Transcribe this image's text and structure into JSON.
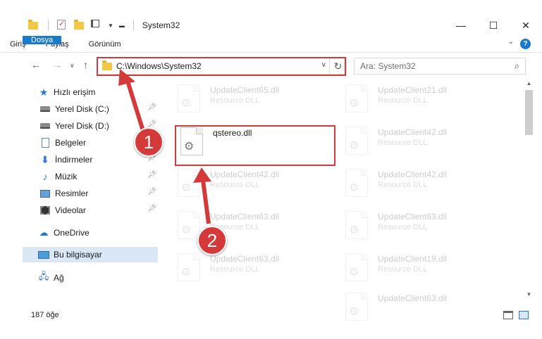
{
  "window": {
    "title": "System32",
    "controls": {
      "minimize": "—",
      "maximize": "☐",
      "close": "✕"
    }
  },
  "ribbon": {
    "tabs": [
      "Dosya",
      "Giriş",
      "Paylaş",
      "Görünüm"
    ],
    "help": "?"
  },
  "address": {
    "path": "C:\\Windows\\System32",
    "search_placeholder": "Ara: System32"
  },
  "nav": {
    "quick_access": "Hızlı erişim",
    "items": [
      {
        "label": "Yerel Disk (C:)",
        "icon": "disk-icon",
        "pinned": true
      },
      {
        "label": "Yerel Disk (D:)",
        "icon": "disk-icon",
        "pinned": true
      },
      {
        "label": "Belgeler",
        "icon": "documents-icon",
        "pinned": false
      },
      {
        "label": "İndirmeler",
        "icon": "downloads-icon",
        "pinned": true
      },
      {
        "label": "Müzik",
        "icon": "music-icon",
        "pinned": true
      },
      {
        "label": "Resimler",
        "icon": "pictures-icon",
        "pinned": true
      },
      {
        "label": "Videolar",
        "icon": "videos-icon",
        "pinned": true
      }
    ],
    "onedrive": "OneDrive",
    "this_pc": "Bu bilgisayar",
    "network": "Ağ"
  },
  "files": {
    "highlighted": {
      "name": "qstereo.dll"
    },
    "left_column": [
      {
        "name": "UpdateClient65.dll",
        "type": "Resource DLL"
      },
      {
        "name": "UpdateClient42.dll",
        "type": "Resource DLL"
      },
      {
        "name": "UpdateClient63.dll",
        "type": "Resource DLL"
      },
      {
        "name": "UpdateClient63.dll",
        "type": "Resource DLL"
      }
    ],
    "right_column": [
      {
        "name": "UpdateClient21.dll",
        "type": "Resource DLL"
      },
      {
        "name": "UpdateClient42.dll",
        "type": "Resource DLL"
      },
      {
        "name": "UpdateClient42.dll",
        "type": "Resource DLL"
      },
      {
        "name": "UpdateClient63.dll",
        "type": "Resource DLL"
      },
      {
        "name": "UpdateClient19.dll",
        "type": "Resource DLL"
      },
      {
        "name": "UpdateClient63.dll",
        "type": "Resource DLL"
      }
    ]
  },
  "status": {
    "count": "187 öğe"
  },
  "callouts": {
    "first": "1",
    "second": "2"
  },
  "colors": {
    "accent": "#1979ca",
    "callout": "#d43a3a",
    "selection": "#d9e7f6"
  }
}
